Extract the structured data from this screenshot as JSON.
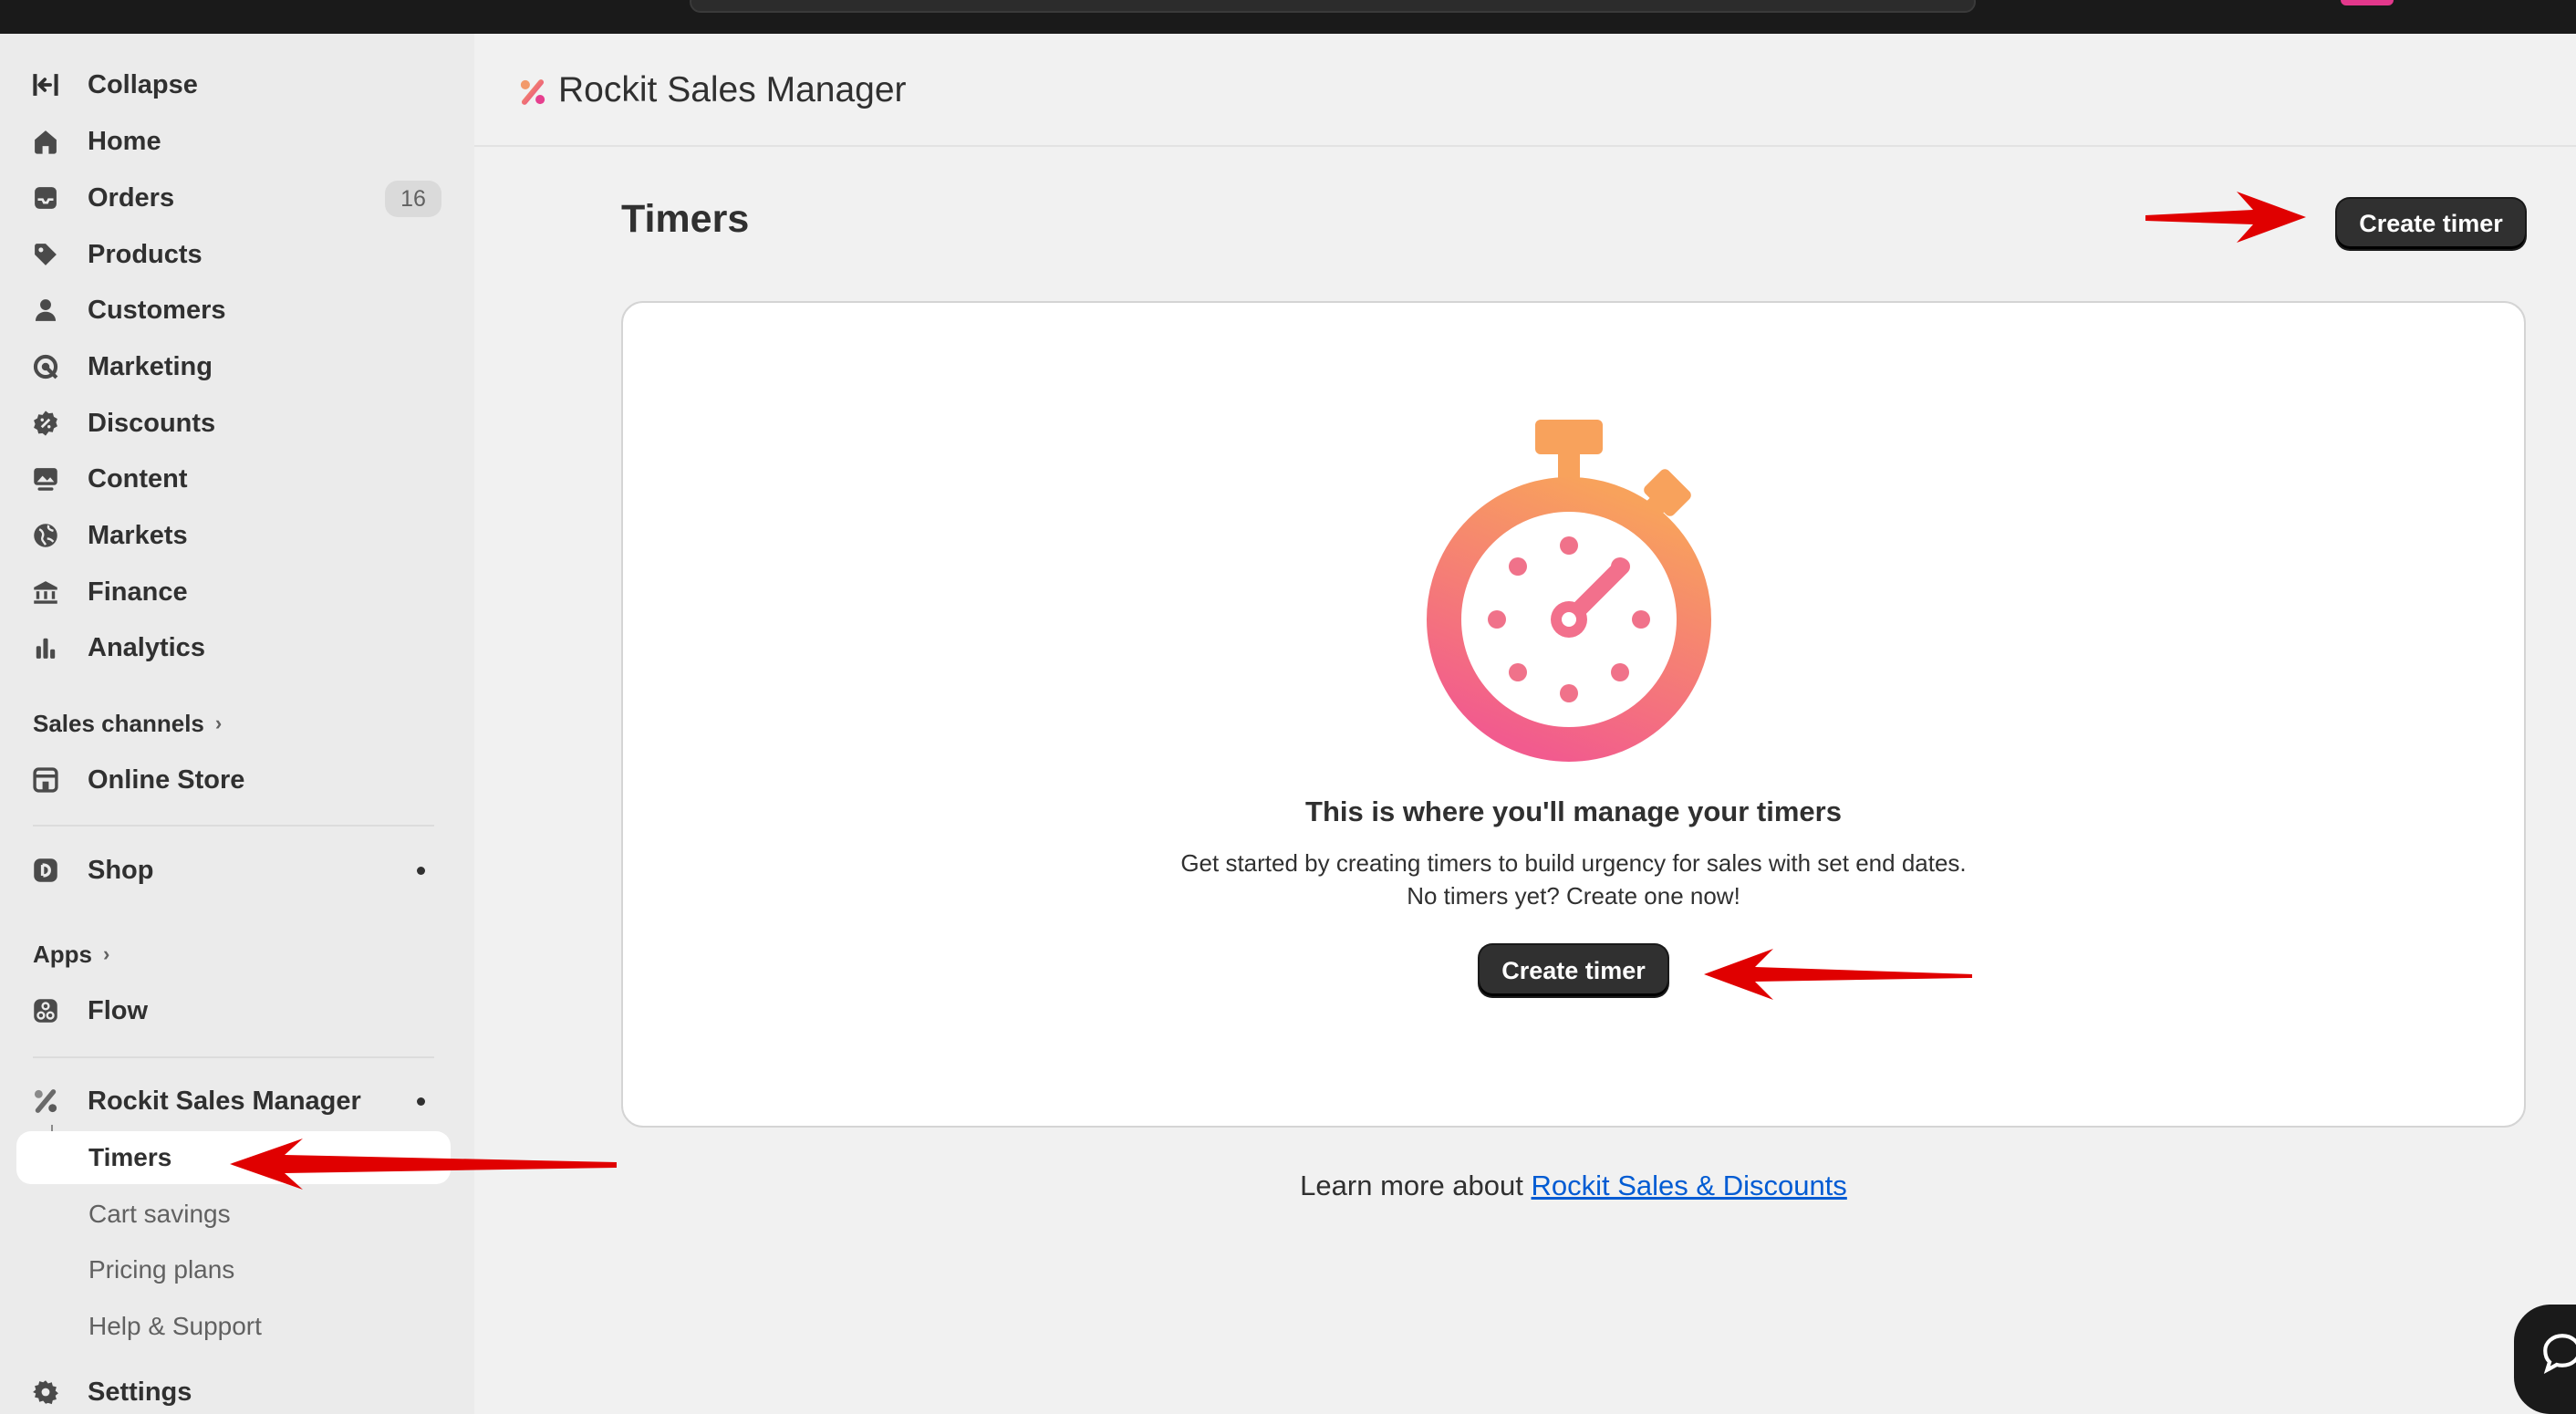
{
  "sidebar": {
    "collapse_label": "Collapse",
    "items": [
      {
        "label": "Home",
        "icon": "home-icon"
      },
      {
        "label": "Orders",
        "icon": "inbox-icon",
        "badge": "16"
      },
      {
        "label": "Products",
        "icon": "tag-icon"
      },
      {
        "label": "Customers",
        "icon": "person-icon"
      },
      {
        "label": "Marketing",
        "icon": "target-icon"
      },
      {
        "label": "Discounts",
        "icon": "discount-icon"
      },
      {
        "label": "Content",
        "icon": "image-icon"
      },
      {
        "label": "Markets",
        "icon": "globe-icon"
      },
      {
        "label": "Finance",
        "icon": "bank-icon"
      },
      {
        "label": "Analytics",
        "icon": "bar-chart-icon"
      }
    ],
    "sales_channels_label": "Sales channels",
    "online_store_label": "Online Store",
    "shop_label": "Shop",
    "apps_label": "Apps",
    "flow_label": "Flow",
    "app_label": "Rockit Sales Manager",
    "sub_items": [
      "Timers",
      "Cart savings",
      "Pricing plans",
      "Help & Support"
    ],
    "settings_label": "Settings"
  },
  "header": {
    "app_title": "Rockit Sales Manager"
  },
  "page": {
    "title": "Timers",
    "create_button_label": "Create timer"
  },
  "empty_state": {
    "heading": "This is where you'll manage your timers",
    "body": "Get started by creating timers to build urgency for sales with set end dates. No timers yet? Create one now!",
    "button_label": "Create timer"
  },
  "footer": {
    "learn_more_prefix": "Learn more about ",
    "learn_more_link": "Rockit Sales & Discounts"
  },
  "colors": {
    "primary_button": "#303030",
    "link": "#005bd3",
    "annotation_arrow": "#e00000",
    "stopwatch_top": "#f8a25c",
    "stopwatch_bottom": "#f25b8e"
  }
}
